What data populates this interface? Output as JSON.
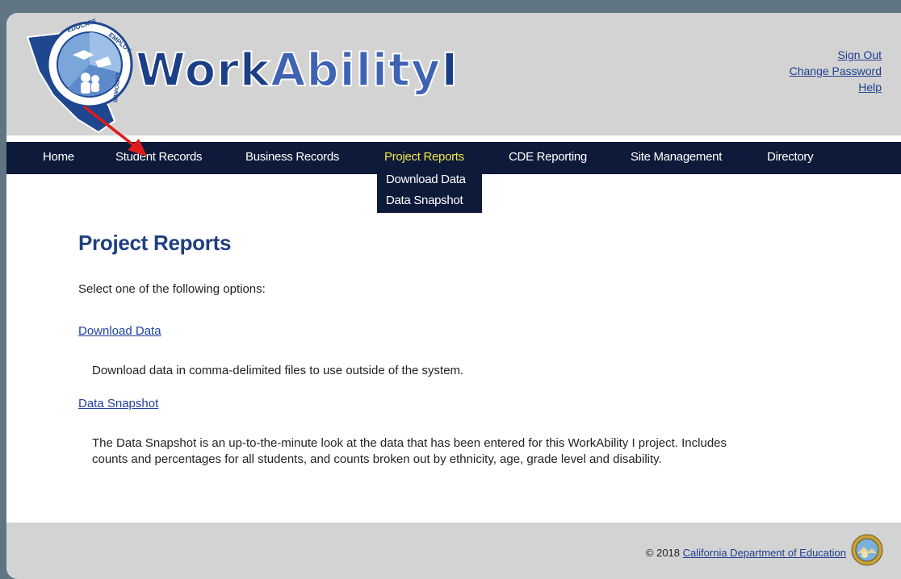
{
  "header": {
    "logo_ring_top": "EDUCATE",
    "logo_ring_right": "EMPLOY",
    "logo_ring_bottom": "EMPOWER",
    "brand_part1": "Work",
    "brand_part2": "Ability",
    "brand_part3": "I",
    "links": {
      "sign_out": "Sign Out",
      "change_password": "Change Password",
      "help": "Help"
    }
  },
  "nav": {
    "items": [
      {
        "label": "Home"
      },
      {
        "label": "Student Records"
      },
      {
        "label": "Business Records"
      },
      {
        "label": "Project Reports"
      },
      {
        "label": "CDE Reporting"
      },
      {
        "label": "Site Management"
      },
      {
        "label": "Directory"
      }
    ],
    "active_item": "Project Reports",
    "dropdown": [
      "Download Data",
      "Data Snapshot"
    ]
  },
  "main": {
    "title": "Project Reports",
    "intro": "Select one of the following options:",
    "options": [
      {
        "link": "Download Data",
        "description": "Download data in comma-delimited files to use outside of the system."
      },
      {
        "link": "Data Snapshot",
        "description_line1": "The Data Snapshot is an up-to-the-minute look at the data that has been entered for this WorkAbility I project. Includes",
        "description_line2": "counts and percentages for all students, and counts broken out by ethnicity, age, grade level and disability."
      }
    ]
  },
  "footer": {
    "copyright_prefix": "© 2018",
    "org_link": "California Department of Education"
  },
  "colors": {
    "nav_bg": "#0d1a3a",
    "nav_active": "#f2e64a",
    "header_bg": "#d3d3d3",
    "title": "#1f3f7f",
    "link": "#1e3fa0",
    "annotation_arrow": "#e01b1b"
  },
  "icons": {
    "logo": "workability-california-logo-icon",
    "seal": "california-state-seal-icon",
    "annotation": "red-arrow-icon"
  }
}
